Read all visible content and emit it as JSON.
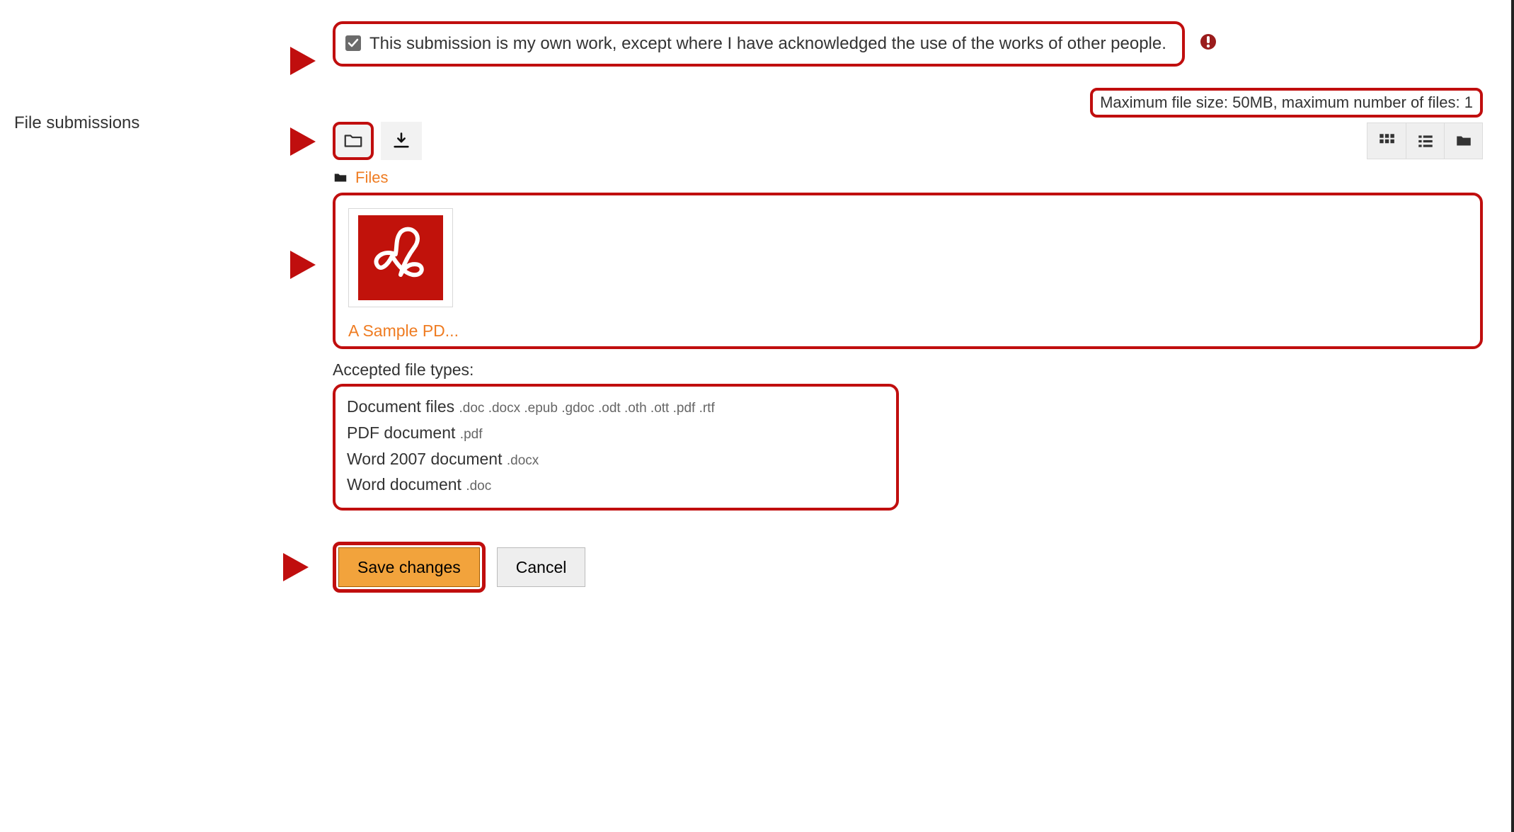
{
  "declaration": {
    "checked": true,
    "text": "This submission is my own work, except where I have acknowledged the use of the works of other people."
  },
  "section_label": "File submissions",
  "limits_text": "Maximum file size: 50MB, maximum number of files: 1",
  "breadcrumb": {
    "files_label": "Files"
  },
  "file": {
    "name": "A Sample PD..."
  },
  "accepted": {
    "label": "Accepted file types:",
    "entries": [
      {
        "name": "Document files",
        "ext": ".doc .docx .epub .gdoc .odt .oth .ott .pdf .rtf"
      },
      {
        "name": "PDF document",
        "ext": ".pdf"
      },
      {
        "name": "Word 2007 document",
        "ext": ".docx"
      },
      {
        "name": "Word document",
        "ext": ".doc"
      }
    ]
  },
  "actions": {
    "save": "Save changes",
    "cancel": "Cancel"
  }
}
